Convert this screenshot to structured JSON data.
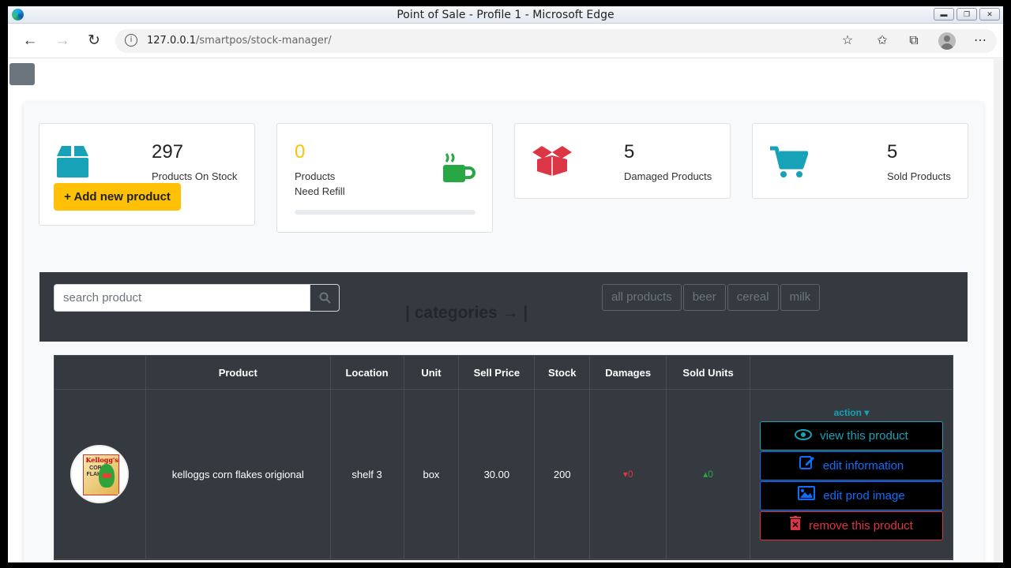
{
  "window": {
    "title": "Point of Sale - Profile 1 - Microsoft Edge"
  },
  "browser": {
    "url_host": "127.0.0.1",
    "url_path": "/smartpos/stock-manager/"
  },
  "stats": {
    "stock": {
      "value": "297",
      "label": "Products On Stock",
      "add_label": "Add new product"
    },
    "refill": {
      "value": "0",
      "label_line1": "Products",
      "label_line2": "Need Refill",
      "progress": 0
    },
    "damaged": {
      "value": "5",
      "label": "Damaged Products"
    },
    "sold": {
      "value": "5",
      "label": "Sold Products"
    }
  },
  "search": {
    "placeholder": "search product"
  },
  "categories": {
    "label": "| categories → |",
    "items": [
      "all products",
      "beer",
      "cereal",
      "milk"
    ]
  },
  "table": {
    "headers": [
      "",
      "Product",
      "Location",
      "Unit",
      "Sell Price",
      "Stock",
      "Damages",
      "Sold Units",
      ""
    ],
    "rows": [
      {
        "product": "kelloggs corn flakes origional",
        "location": "shelf 3",
        "unit": "box",
        "sell_price": "30.00",
        "stock": "200",
        "damages": "0",
        "sold_units": "0",
        "image": {
          "logo": "Kellogg's",
          "line1": "CORN",
          "line2": "FLAKES"
        }
      }
    ],
    "action": {
      "toggle": "action",
      "view": "view this product",
      "edit": "edit information",
      "image": "edit prod image",
      "remove": "remove this product"
    }
  },
  "colors": {
    "teal": "#17a2b8",
    "yellow": "#ffc107",
    "green": "#28a745",
    "red": "#dc3545",
    "dark": "#343a40",
    "blue": "#0d6efd"
  }
}
